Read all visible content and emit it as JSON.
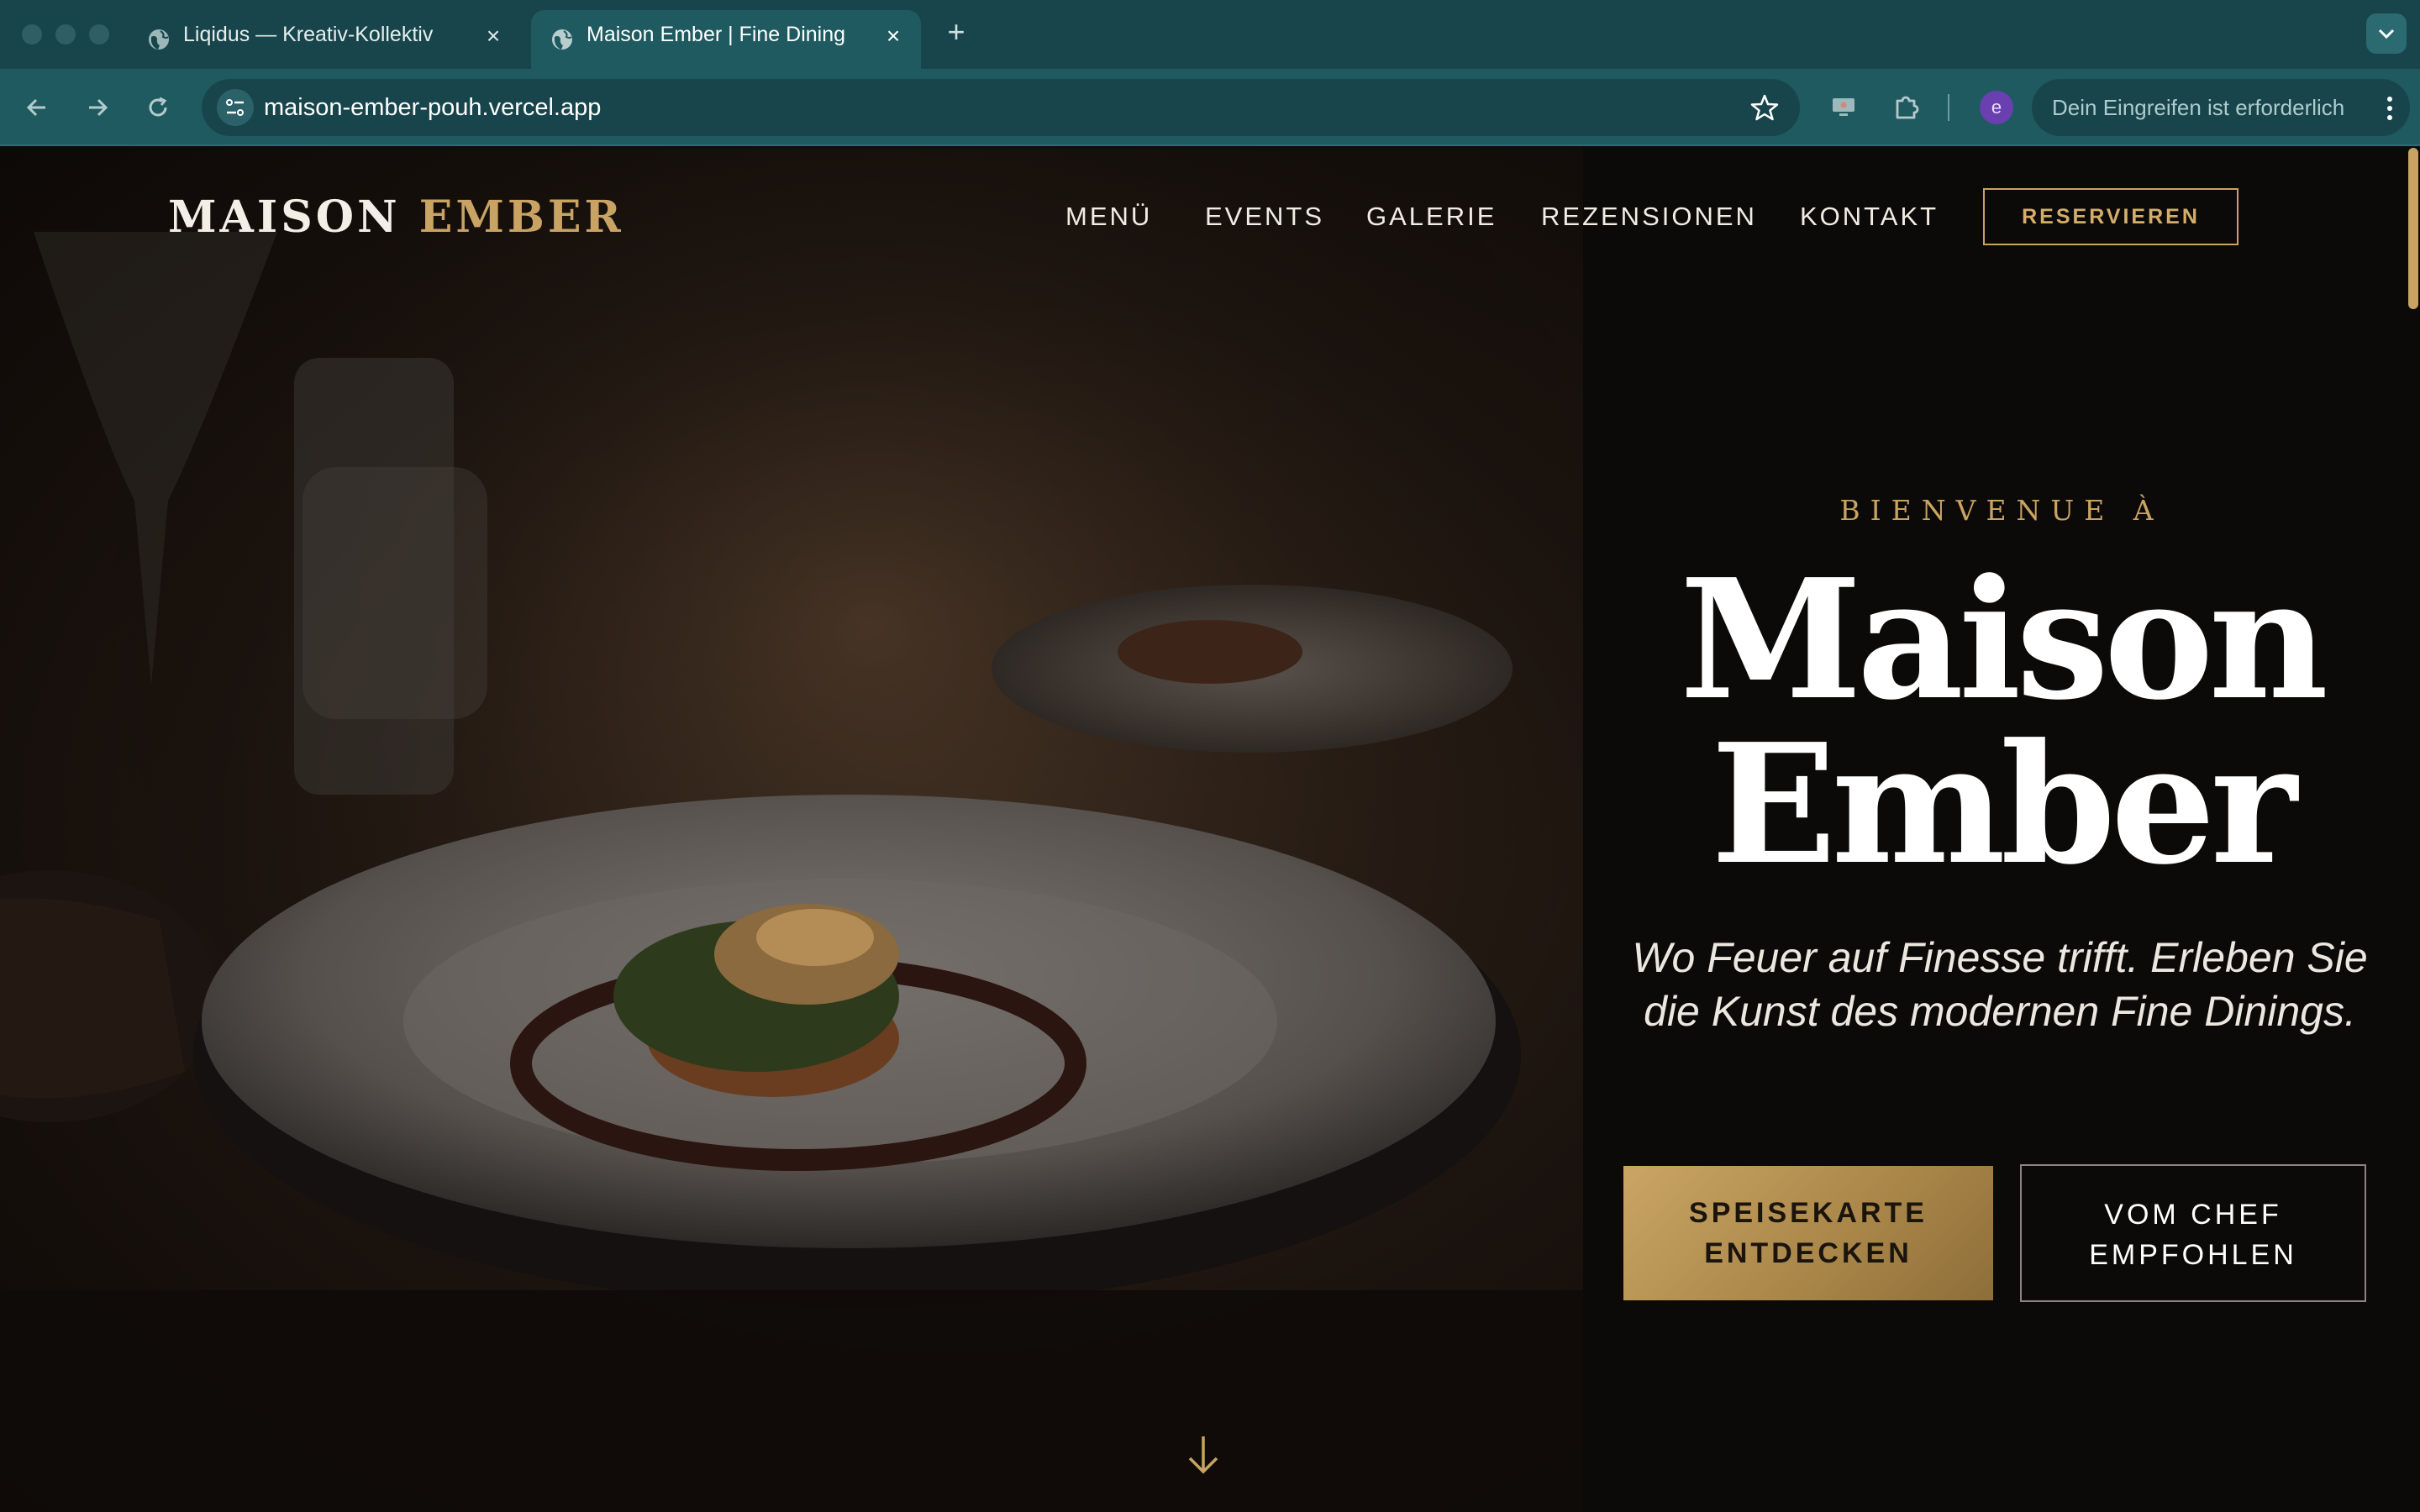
{
  "browser": {
    "tabs": [
      {
        "title": "Liqidus — Kreativ-Kollektiv",
        "active": false
      },
      {
        "title": "Maison Ember | Fine Dining",
        "active": true
      }
    ],
    "new_tab_icon": "plus-icon",
    "url": "maison-ember-pouh.vercel.app",
    "profile_initial": "e",
    "notice": "Dein Eingreifen ist erforderlich"
  },
  "site": {
    "logo_primary": "MAISON",
    "logo_accent": "EMBER",
    "nav": [
      "MENÜ",
      "EVENTS",
      "GALERIE",
      "REZENSIONEN",
      "KONTAKT"
    ],
    "reserve_label": "RESERVIEREN",
    "hero": {
      "eyebrow": "BIENVENUE À",
      "title_line1": "Maison",
      "title_line2": "Ember",
      "subtitle": "Wo Feuer auf Finesse trifft. Erleben Sie die Kunst des modernen Fine Dinings.",
      "primary_line1": "SPEISEKARTE",
      "primary_line2": "ENTDECKEN",
      "secondary_line1": "VOM CHEF",
      "secondary_line2": "EMPFOHLEN"
    }
  },
  "colors": {
    "chrome_bg": "#17454b",
    "chrome_toolbar": "#1f5a60",
    "accent_gold": "#c9a363",
    "page_bg": "#0c0a09"
  }
}
